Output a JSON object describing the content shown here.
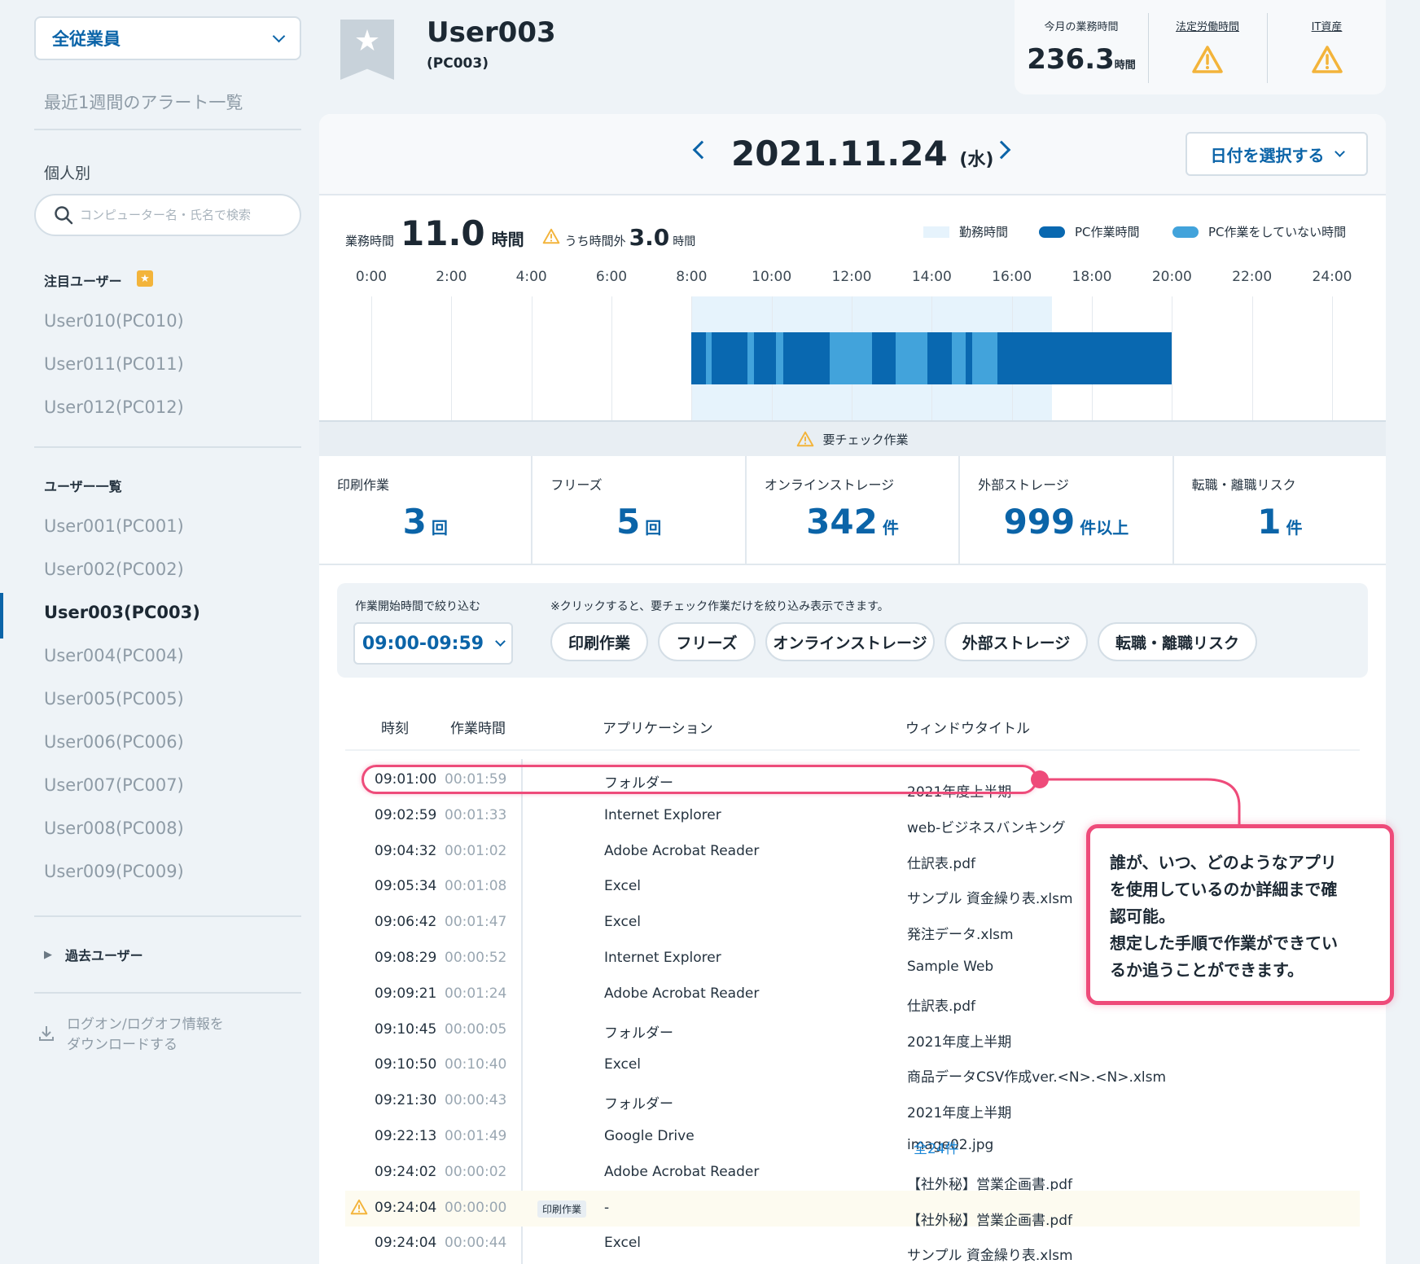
{
  "sidebar": {
    "scope_label": "全従業員",
    "alerts_link": "最近1週間のアラート一覧",
    "individual_label": "個人別",
    "search_placeholder": "コンピューター名・氏名で検索",
    "watched_heading": "注目ユーザー",
    "watched_users": [
      "User010(PC010)",
      "User011(PC011)",
      "User012(PC012)"
    ],
    "user_list_heading": "ユーザー一覧",
    "users": [
      "User001(PC001)",
      "User002(PC002)",
      "User003(PC003)",
      "User004(PC004)",
      "User005(PC005)",
      "User006(PC006)",
      "User007(PC007)",
      "User008(PC008)",
      "User009(PC009)"
    ],
    "active_user": "User003(PC003)",
    "past_users": "過去ユーザー",
    "download_line1": "ログオン/ログオフ情報を",
    "download_line2": "ダウンロードする"
  },
  "header": {
    "user_name": "User003",
    "pc_name": "(PC003)"
  },
  "summary": {
    "month_hours_label": "今月の業務時間",
    "month_hours_value": "236.3",
    "month_hours_unit": "時間",
    "legal_label": "法定労働時間",
    "it_label": "IT資産"
  },
  "date_nav": {
    "date": "2021.11.24",
    "weekday": "(水)",
    "picker_label": "日付を選択する"
  },
  "work_summary": {
    "label": "業務時間",
    "hours": "11.0",
    "unit": "時間",
    "overtime_label": "うち時間外",
    "overtime_hours": "3.0",
    "overtime_unit": "時間"
  },
  "legend": {
    "duty": "勤務時間",
    "pc": "PC作業時間",
    "idle": "PC作業をしていない時間"
  },
  "colors": {
    "accent": "#0b64a8",
    "duty": "#e6f3fc",
    "pc_work": "#0968b0",
    "pc_idle": "#42a3db",
    "highlight": "#ee4b7a",
    "warning": "#f3b43b"
  },
  "timeline": {
    "ticks": [
      "0:00",
      "2:00",
      "4:00",
      "6:00",
      "8:00",
      "10:00",
      "12:00",
      "14:00",
      "16:00",
      "18:00",
      "20:00",
      "22:00",
      "24:00"
    ],
    "duty_start": 8,
    "duty_end": 17,
    "segments": [
      {
        "start": 8.0,
        "end": 8.35,
        "kind": "pc"
      },
      {
        "start": 8.35,
        "end": 8.5,
        "kind": "idle"
      },
      {
        "start": 8.5,
        "end": 9.4,
        "kind": "pc"
      },
      {
        "start": 9.4,
        "end": 9.55,
        "kind": "idle"
      },
      {
        "start": 9.55,
        "end": 10.1,
        "kind": "pc"
      },
      {
        "start": 10.1,
        "end": 10.3,
        "kind": "idle"
      },
      {
        "start": 10.3,
        "end": 11.45,
        "kind": "pc"
      },
      {
        "start": 11.45,
        "end": 12.5,
        "kind": "idle"
      },
      {
        "start": 12.5,
        "end": 13.1,
        "kind": "pc"
      },
      {
        "start": 13.1,
        "end": 13.9,
        "kind": "idle"
      },
      {
        "start": 13.9,
        "end": 14.5,
        "kind": "pc"
      },
      {
        "start": 14.5,
        "end": 14.85,
        "kind": "idle"
      },
      {
        "start": 14.85,
        "end": 15.0,
        "kind": "pc"
      },
      {
        "start": 15.0,
        "end": 15.65,
        "kind": "idle"
      },
      {
        "start": 15.65,
        "end": 20.0,
        "kind": "pc"
      }
    ]
  },
  "check_bar": {
    "label": "要チェック作業"
  },
  "stats": [
    {
      "label": "印刷作業",
      "value": "3",
      "unit": "回"
    },
    {
      "label": "フリーズ",
      "value": "5",
      "unit": "回"
    },
    {
      "label": "オンラインストレージ",
      "value": "342",
      "unit": "件"
    },
    {
      "label": "外部ストレージ",
      "value": "999",
      "unit": "件以上"
    },
    {
      "label": "転職・離職リスク",
      "value": "1",
      "unit": "件"
    }
  ],
  "filter": {
    "title": "作業開始時間で絞り込む",
    "time_value": "09:00-09:59",
    "note": "※クリックすると、要チェック作業だけを絞り込み表示できます。",
    "chips": [
      "印刷作業",
      "フリーズ",
      "オンラインストレージ",
      "外部ストレージ",
      "転職・離職リスク"
    ]
  },
  "log_table": {
    "headers": [
      "時刻",
      "作業時間",
      "アプリケーション",
      "ウィンドウタイトル"
    ],
    "rows": [
      {
        "time": "09:01:00",
        "duration": "00:01:59",
        "app": "フォルダー",
        "window": "2021年度上半期"
      },
      {
        "time": "09:02:59",
        "duration": "00:01:33",
        "app": "Internet Explorer",
        "window": "web-ビジネスバンキング"
      },
      {
        "time": "09:04:32",
        "duration": "00:01:02",
        "app": "Adobe Acrobat Reader",
        "window": "仕訳表.pdf"
      },
      {
        "time": "09:05:34",
        "duration": "00:01:08",
        "app": "Excel",
        "window": "サンプル 資金繰り表.xlsm"
      },
      {
        "time": "09:06:42",
        "duration": "00:01:47",
        "app": "Excel",
        "window": "発注データ.xlsm"
      },
      {
        "time": "09:08:29",
        "duration": "00:00:52",
        "app": "Internet Explorer",
        "window": "Sample Web"
      },
      {
        "time": "09:09:21",
        "duration": "00:01:24",
        "app": "Adobe Acrobat Reader",
        "window": "仕訳表.pdf"
      },
      {
        "time": "09:10:45",
        "duration": "00:00:05",
        "app": "フォルダー",
        "window": "2021年度上半期"
      },
      {
        "time": "09:10:50",
        "duration": "00:10:40",
        "app": "Excel",
        "window": "商品データCSV作成ver.<N>.<N>.xlsm"
      },
      {
        "time": "09:21:30",
        "duration": "00:00:43",
        "app": "フォルダー",
        "window": "2021年度上半期"
      },
      {
        "time": "09:22:13",
        "duration": "00:01:49",
        "app": "Google Drive",
        "window": "image02.jpg",
        "more": "全24件"
      },
      {
        "time": "09:24:02",
        "duration": "00:00:02",
        "app": "Adobe Acrobat Reader",
        "window": "【社外秘】営業企画書.pdf"
      },
      {
        "time": "09:24:04",
        "duration": "00:00:00",
        "app": "-",
        "window": "【社外秘】営業企画書.pdf",
        "tag": "印刷作業",
        "warn": true
      },
      {
        "time": "09:24:04",
        "duration": "00:00:44",
        "app": "Excel",
        "window": "サンプル 資金繰り表.xlsm"
      }
    ]
  },
  "callout": {
    "lines": [
      "誰が、いつ、どのようなアプリ",
      "を使用しているのか詳細まで確",
      "認可能。",
      "想定した手順で作業ができてい",
      "るか追うことができます。"
    ]
  }
}
